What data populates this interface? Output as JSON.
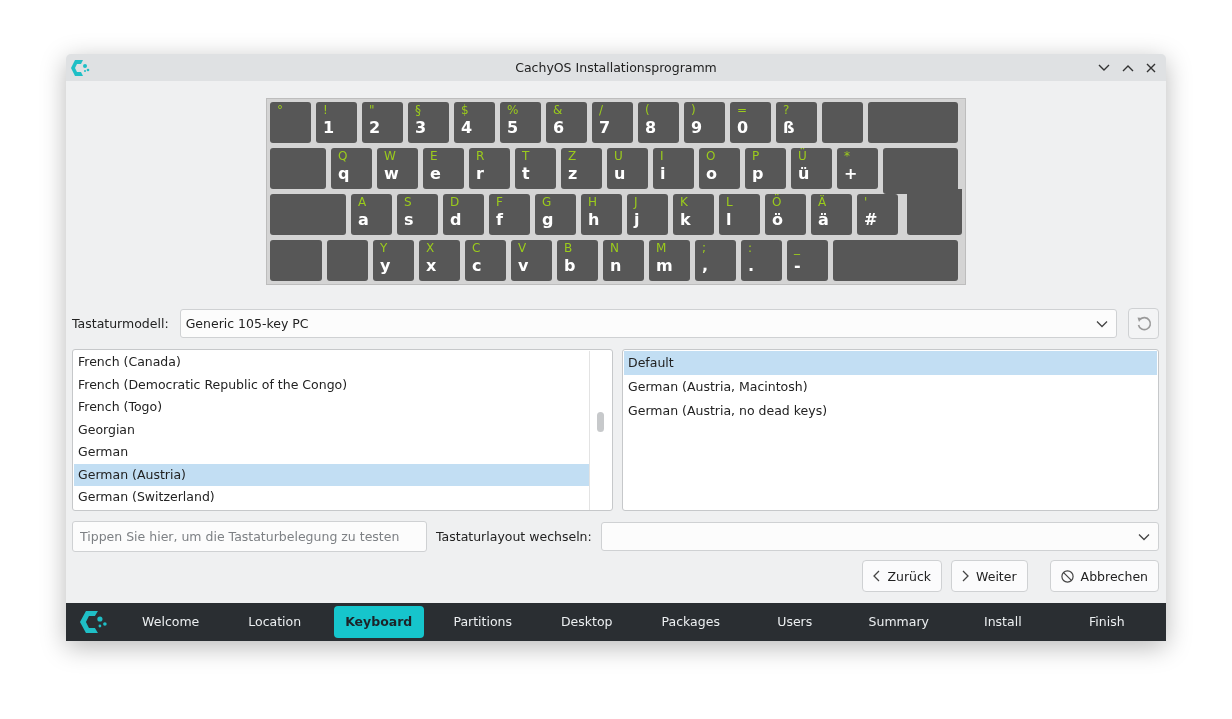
{
  "window": {
    "title": "CachyOS Installationsprogramm"
  },
  "keyboard": {
    "rows": [
      {
        "keys": [
          {
            "kind": "char",
            "upper": "°"
          },
          {
            "kind": "char",
            "upper": "!",
            "lower": "1"
          },
          {
            "kind": "char",
            "upper": "\"",
            "lower": "2"
          },
          {
            "kind": "char",
            "upper": "§",
            "lower": "3"
          },
          {
            "kind": "char",
            "upper": "$",
            "lower": "4"
          },
          {
            "kind": "char",
            "upper": "%",
            "lower": "5"
          },
          {
            "kind": "char",
            "upper": "&",
            "lower": "6"
          },
          {
            "kind": "char",
            "upper": "/",
            "lower": "7"
          },
          {
            "kind": "char",
            "upper": "(",
            "lower": "8"
          },
          {
            "kind": "char",
            "upper": ")",
            "lower": "9"
          },
          {
            "kind": "char",
            "upper": "=",
            "lower": "0"
          },
          {
            "kind": "char",
            "upper": "?",
            "lower": "ß"
          },
          {
            "kind": "blank"
          },
          {
            "kind": "backspace"
          }
        ]
      },
      {
        "keys": [
          {
            "kind": "tab"
          },
          {
            "kind": "char",
            "upper": "Q",
            "lower": "q"
          },
          {
            "kind": "char",
            "upper": "W",
            "lower": "w"
          },
          {
            "kind": "char",
            "upper": "E",
            "lower": "e"
          },
          {
            "kind": "char",
            "upper": "R",
            "lower": "r"
          },
          {
            "kind": "char",
            "upper": "T",
            "lower": "t"
          },
          {
            "kind": "char",
            "upper": "Z",
            "lower": "z"
          },
          {
            "kind": "char",
            "upper": "U",
            "lower": "u"
          },
          {
            "kind": "char",
            "upper": "I",
            "lower": "i"
          },
          {
            "kind": "char",
            "upper": "O",
            "lower": "o"
          },
          {
            "kind": "char",
            "upper": "P",
            "lower": "p"
          },
          {
            "kind": "char",
            "upper": "Ü",
            "lower": "ü"
          },
          {
            "kind": "char",
            "upper": "*",
            "lower": "+"
          },
          {
            "kind": "enter"
          }
        ]
      },
      {
        "keys": [
          {
            "kind": "caps"
          },
          {
            "kind": "char",
            "upper": "A",
            "lower": "a"
          },
          {
            "kind": "char",
            "upper": "S",
            "lower": "s"
          },
          {
            "kind": "char",
            "upper": "D",
            "lower": "d"
          },
          {
            "kind": "char",
            "upper": "F",
            "lower": "f"
          },
          {
            "kind": "char",
            "upper": "G",
            "lower": "g"
          },
          {
            "kind": "char",
            "upper": "H",
            "lower": "h"
          },
          {
            "kind": "char",
            "upper": "J",
            "lower": "j"
          },
          {
            "kind": "char",
            "upper": "K",
            "lower": "k"
          },
          {
            "kind": "char",
            "upper": "L",
            "lower": "l"
          },
          {
            "kind": "char",
            "upper": "Ö",
            "lower": "ö"
          },
          {
            "kind": "char",
            "upper": "Ä",
            "lower": "ä"
          },
          {
            "kind": "char",
            "upper": "'",
            "lower": "#"
          },
          {
            "kind": "enter-lower"
          }
        ]
      },
      {
        "keys": [
          {
            "kind": "shift"
          },
          {
            "kind": "blank"
          },
          {
            "kind": "char",
            "upper": "Y",
            "lower": "y"
          },
          {
            "kind": "char",
            "upper": "X",
            "lower": "x"
          },
          {
            "kind": "char",
            "upper": "C",
            "lower": "c"
          },
          {
            "kind": "char",
            "upper": "V",
            "lower": "v"
          },
          {
            "kind": "char",
            "upper": "B",
            "lower": "b"
          },
          {
            "kind": "char",
            "upper": "N",
            "lower": "n"
          },
          {
            "kind": "char",
            "upper": "M",
            "lower": "m"
          },
          {
            "kind": "char",
            "upper": ";",
            "lower": ","
          },
          {
            "kind": "char",
            "upper": ":",
            "lower": "."
          },
          {
            "kind": "char",
            "upper": "_",
            "lower": "-"
          },
          {
            "kind": "rshift"
          }
        ]
      }
    ]
  },
  "model": {
    "label": "Tastaturmodell:",
    "value": "Generic 105-key PC"
  },
  "layouts": [
    {
      "label": "French (Canada)",
      "selected": false
    },
    {
      "label": "French (Democratic Republic of the Congo)",
      "selected": false
    },
    {
      "label": "French (Togo)",
      "selected": false
    },
    {
      "label": "Georgian",
      "selected": false
    },
    {
      "label": "German",
      "selected": false
    },
    {
      "label": "German (Austria)",
      "selected": true
    },
    {
      "label": "German (Switzerland)",
      "selected": false
    }
  ],
  "variants": [
    {
      "label": "Default",
      "selected": true
    },
    {
      "label": "German (Austria, Macintosh)",
      "selected": false
    },
    {
      "label": "German (Austria, no dead keys)",
      "selected": false
    }
  ],
  "test_field": {
    "placeholder": "Tippen Sie hier, um die Tastaturbelegung zu testen"
  },
  "switch": {
    "label": "Tastaturlayout wechseln:"
  },
  "buttons": [
    {
      "kind": "back",
      "label": "Zurück"
    },
    {
      "kind": "next",
      "label": "Weiter"
    },
    {
      "kind": "cancel",
      "label": "Abbrechen"
    }
  ],
  "steps": [
    {
      "label": "Welcome",
      "selected": false
    },
    {
      "label": "Location",
      "selected": false
    },
    {
      "label": "Keyboard",
      "selected": true
    },
    {
      "label": "Partitions",
      "selected": false
    },
    {
      "label": "Desktop",
      "selected": false
    },
    {
      "label": "Packages",
      "selected": false
    },
    {
      "label": "Users",
      "selected": false
    },
    {
      "label": "Summary",
      "selected": false
    },
    {
      "label": "Install",
      "selected": false
    },
    {
      "label": "Finish",
      "selected": false
    }
  ]
}
